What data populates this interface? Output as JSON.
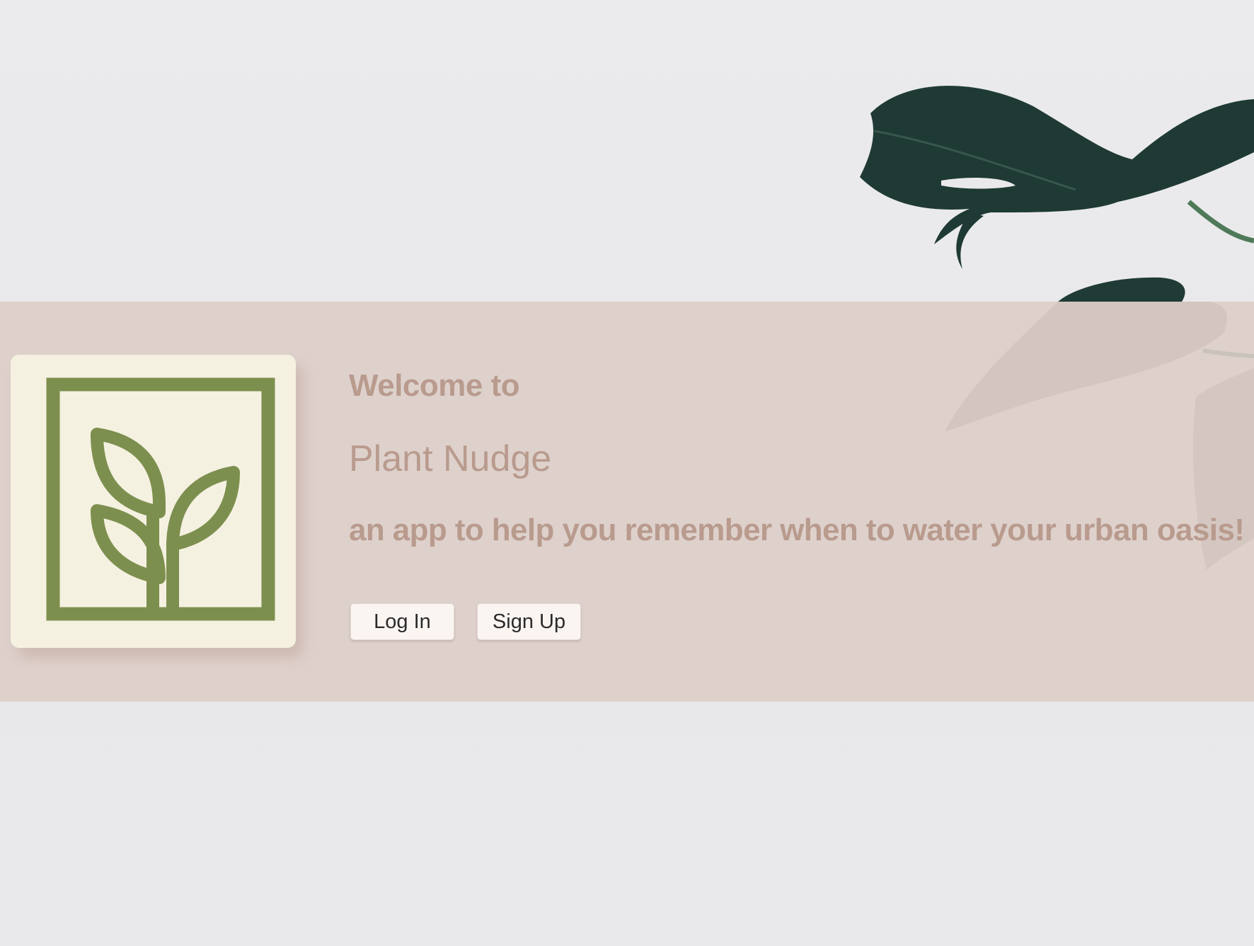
{
  "background": {
    "image": "monstera-leaves-photo",
    "color": "#e9e9eb"
  },
  "hero": {
    "band_color": "#dccdc7",
    "welcome": "Welcome to",
    "app_name": "Plant Nudge",
    "tagline": "an app to help you remember when to water your urban oasis!",
    "text_color": "#b99b8e"
  },
  "logo": {
    "icon": "sprout-icon",
    "card_color": "#f5f1e1",
    "mark_color": "#7d8f4e"
  },
  "actions": {
    "login_label": "Log In",
    "signup_label": "Sign Up"
  }
}
